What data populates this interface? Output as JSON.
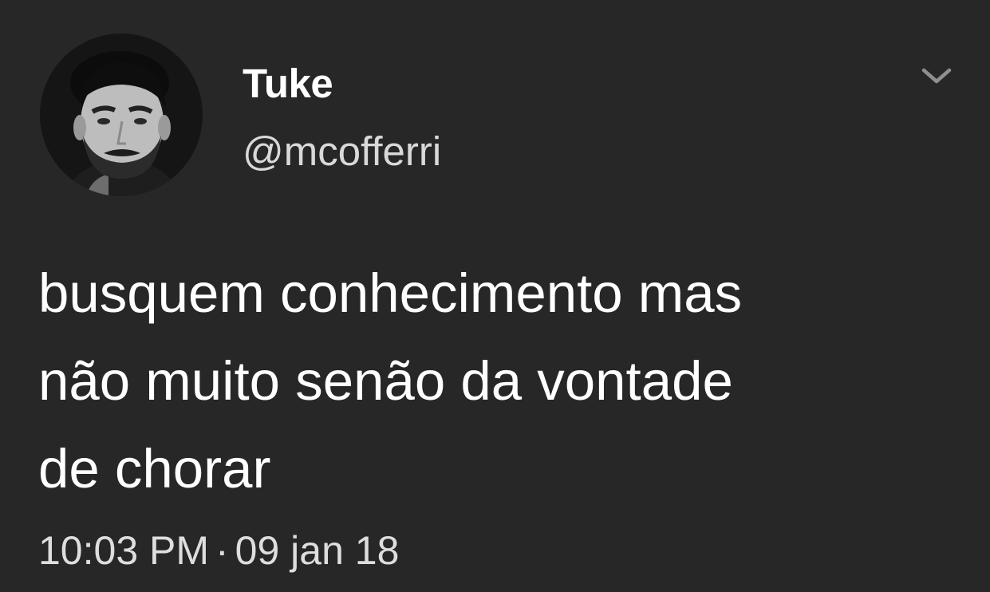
{
  "tweet": {
    "author": {
      "display_name": "Tuke",
      "handle": "@mcofferri",
      "avatar_icon": "profile-photo"
    },
    "menu_icon": "chevron-down-icon",
    "text": "busquem conhecimento mas\nnão muito senão da vontade\nde chorar",
    "time": "10:03 PM",
    "separator": "·",
    "date": "09 jan 18"
  },
  "colors": {
    "background": "#272727",
    "text": "#ffffff",
    "secondary_text": "#d9d9d9",
    "chevron": "#8f8f8f"
  }
}
